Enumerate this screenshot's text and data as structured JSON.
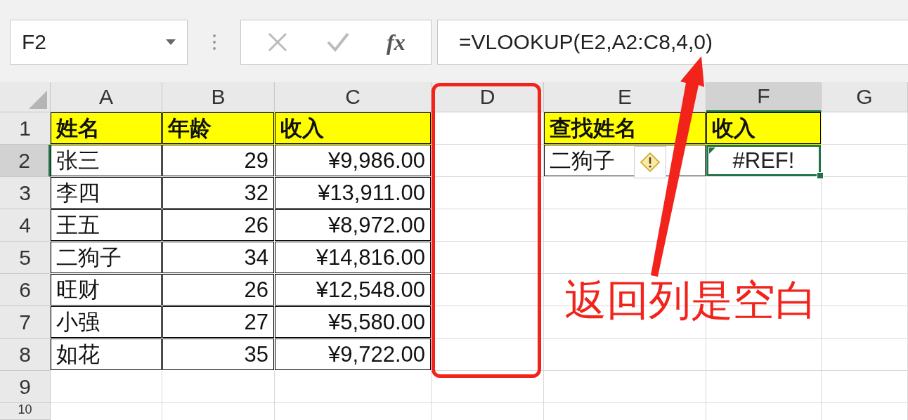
{
  "formula_bar": {
    "name_box": "F2",
    "fx_label": "fx",
    "formula": "=VLOOKUP(E2,A2:C8,4,0)"
  },
  "columns": [
    {
      "label": "A",
      "selected": false
    },
    {
      "label": "B",
      "selected": false
    },
    {
      "label": "C",
      "selected": false
    },
    {
      "label": "D",
      "selected": false
    },
    {
      "label": "E",
      "selected": false
    },
    {
      "label": "F",
      "selected": true
    },
    {
      "label": "G",
      "selected": false
    }
  ],
  "rows": [
    {
      "number": "1",
      "selected": false,
      "cells": [
        {
          "kind": "header",
          "text": "姓名"
        },
        {
          "kind": "header",
          "text": "年龄"
        },
        {
          "kind": "header",
          "text": "收入"
        },
        {
          "kind": "empty"
        },
        {
          "kind": "header",
          "text": "查找姓名"
        },
        {
          "kind": "header",
          "text": "收入"
        },
        {
          "kind": "empty"
        }
      ]
    },
    {
      "number": "2",
      "selected": true,
      "cells": [
        {
          "kind": "text",
          "text": "张三"
        },
        {
          "kind": "number",
          "text": "29"
        },
        {
          "kind": "number",
          "text": "¥9,986.00"
        },
        {
          "kind": "empty"
        },
        {
          "kind": "text",
          "text": "二狗子",
          "flag": true
        },
        {
          "kind": "error",
          "text": "#REF!"
        },
        {
          "kind": "empty"
        }
      ]
    },
    {
      "number": "3",
      "selected": false,
      "cells": [
        {
          "kind": "text",
          "text": "李四"
        },
        {
          "kind": "number",
          "text": "32"
        },
        {
          "kind": "number",
          "text": "¥13,911.00"
        },
        {
          "kind": "empty"
        },
        {
          "kind": "empty"
        },
        {
          "kind": "empty"
        },
        {
          "kind": "empty"
        }
      ]
    },
    {
      "number": "4",
      "selected": false,
      "cells": [
        {
          "kind": "text",
          "text": "王五"
        },
        {
          "kind": "number",
          "text": "26"
        },
        {
          "kind": "number",
          "text": "¥8,972.00"
        },
        {
          "kind": "empty"
        },
        {
          "kind": "empty"
        },
        {
          "kind": "empty"
        },
        {
          "kind": "empty"
        }
      ]
    },
    {
      "number": "5",
      "selected": false,
      "cells": [
        {
          "kind": "text",
          "text": "二狗子"
        },
        {
          "kind": "number",
          "text": "34"
        },
        {
          "kind": "number",
          "text": "¥14,816.00"
        },
        {
          "kind": "empty"
        },
        {
          "kind": "empty"
        },
        {
          "kind": "empty"
        },
        {
          "kind": "empty"
        }
      ]
    },
    {
      "number": "6",
      "selected": false,
      "cells": [
        {
          "kind": "text",
          "text": "旺财"
        },
        {
          "kind": "number",
          "text": "26"
        },
        {
          "kind": "number",
          "text": "¥12,548.00"
        },
        {
          "kind": "empty"
        },
        {
          "kind": "empty"
        },
        {
          "kind": "empty"
        },
        {
          "kind": "empty"
        }
      ]
    },
    {
      "number": "7",
      "selected": false,
      "cells": [
        {
          "kind": "text",
          "text": "小强"
        },
        {
          "kind": "number",
          "text": "27"
        },
        {
          "kind": "number",
          "text": "¥5,580.00"
        },
        {
          "kind": "empty"
        },
        {
          "kind": "empty"
        },
        {
          "kind": "empty"
        },
        {
          "kind": "empty"
        }
      ]
    },
    {
      "number": "8",
      "selected": false,
      "cells": [
        {
          "kind": "text",
          "text": "如花"
        },
        {
          "kind": "number",
          "text": "35"
        },
        {
          "kind": "number",
          "text": "¥9,722.00"
        },
        {
          "kind": "empty"
        },
        {
          "kind": "empty"
        },
        {
          "kind": "empty"
        },
        {
          "kind": "empty"
        }
      ]
    },
    {
      "number": "9",
      "selected": false,
      "cells": [
        {
          "kind": "empty"
        },
        {
          "kind": "empty"
        },
        {
          "kind": "empty"
        },
        {
          "kind": "empty"
        },
        {
          "kind": "empty"
        },
        {
          "kind": "empty"
        },
        {
          "kind": "empty"
        }
      ]
    },
    {
      "number": "10",
      "selected": false,
      "cells": [
        {
          "kind": "empty"
        },
        {
          "kind": "empty"
        },
        {
          "kind": "empty"
        },
        {
          "kind": "empty"
        },
        {
          "kind": "empty"
        },
        {
          "kind": "empty"
        },
        {
          "kind": "empty"
        }
      ]
    }
  ],
  "annotation": {
    "text": "返回列是空白"
  }
}
